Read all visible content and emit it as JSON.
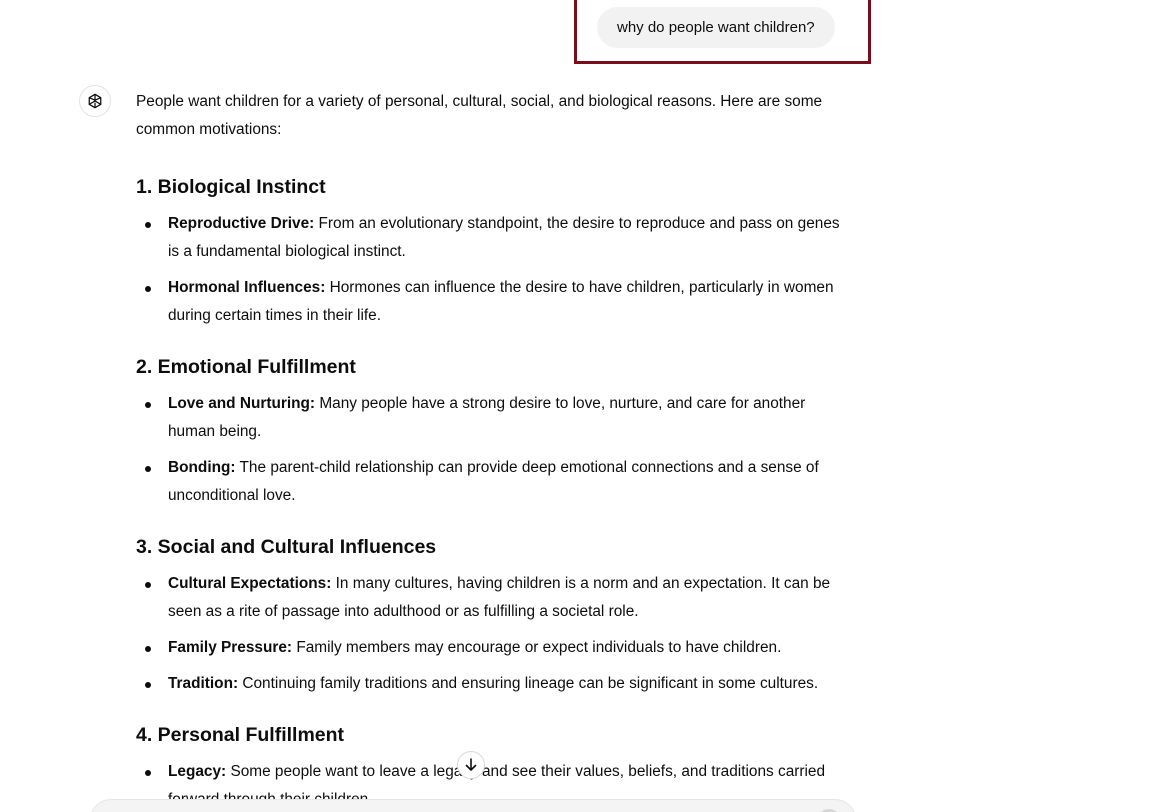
{
  "user_message": "why do people want children?",
  "response": {
    "intro": "People want children for a variety of personal, cultural, social, and biological reasons. Here are some common motivations:",
    "sections": [
      {
        "heading": "1. Biological Instinct",
        "items": [
          {
            "term": "Reproductive Drive:",
            "text": " From an evolutionary standpoint, the desire to reproduce and pass on genes is a fundamental biological instinct."
          },
          {
            "term": "Hormonal Influences:",
            "text": " Hormones can influence the desire to have children, particularly in women during certain times in their life."
          }
        ]
      },
      {
        "heading": "2. Emotional Fulfillment",
        "items": [
          {
            "term": "Love and Nurturing:",
            "text": " Many people have a strong desire to love, nurture, and care for another human being."
          },
          {
            "term": "Bonding:",
            "text": " The parent-child relationship can provide deep emotional connections and a sense of unconditional love."
          }
        ]
      },
      {
        "heading": "3. Social and Cultural Influences",
        "items": [
          {
            "term": "Cultural Expectations:",
            "text": " In many cultures, having children is a norm and an expectation. It can be seen as a rite of passage into adulthood or as fulfilling a societal role."
          },
          {
            "term": "Family Pressure:",
            "text": " Family members may encourage or expect individuals to have children."
          },
          {
            "term": "Tradition:",
            "text": " Continuing family traditions and ensuring lineage can be significant in some cultures."
          }
        ]
      },
      {
        "heading": "4. Personal Fulfillment",
        "items": [
          {
            "term": "Legacy:",
            "text": " Some people want to leave a legacy and see their values, beliefs, and traditions carried forward through their children."
          }
        ]
      }
    ]
  },
  "icons": {
    "avatar": "openai-logo-icon",
    "scroll": "arrow-down-icon"
  },
  "colors": {
    "highlight_border": "#7a0c1e",
    "user_bubble_bg": "#f2f2f2"
  }
}
